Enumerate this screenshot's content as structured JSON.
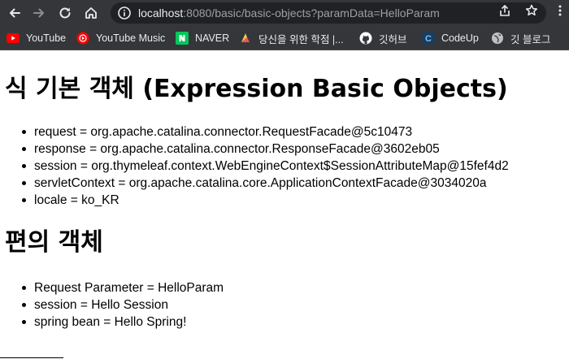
{
  "browser": {
    "url_host": "localhost",
    "url_rest": ":8080/basic/basic-objects?paramData=HelloParam",
    "nav_icons": [
      "back-icon",
      "forward-icon",
      "reload-icon",
      "home-icon"
    ],
    "omnibox_icons": [
      "info-icon",
      "share-icon",
      "bookmark-star-icon"
    ],
    "bookmarks": [
      {
        "label": "YouTube",
        "icon": "youtube-icon",
        "color": "#ff0000"
      },
      {
        "label": "YouTube Music",
        "icon": "youtube-music-icon",
        "color": "#ff0000"
      },
      {
        "label": "NAVER",
        "icon": "naver-icon",
        "color": "#03c75a"
      },
      {
        "label": "당신을 위한 학점 |...",
        "icon": "bookmark-site-icon",
        "color": "#9b51e0"
      },
      {
        "label": "깃허브",
        "icon": "github-icon",
        "color": "#ffffff"
      },
      {
        "label": "CodeUp",
        "icon": "codeup-icon",
        "color": "#1f6fb2"
      },
      {
        "label": "깃 블로그",
        "icon": "globe-icon",
        "color": "#bdc1c6"
      }
    ]
  },
  "page": {
    "heading_basic": "식 기본 객체 (Expression Basic Objects)",
    "basic_items": [
      "request = org.apache.catalina.connector.RequestFacade@5c10473",
      "response = org.apache.catalina.connector.ResponseFacade@3602eb05",
      "session = org.thymeleaf.context.WebEngineContext$SessionAttributeMap@15fef4d2",
      "servletContext = org.apache.catalina.core.ApplicationContextFacade@3034020a",
      "locale = ko_KR"
    ],
    "heading_convenience": "편의 객체",
    "convenience_items": [
      "Request Parameter = HelloParam",
      "session = Hello Session",
      "spring bean = Hello Spring!"
    ]
  }
}
